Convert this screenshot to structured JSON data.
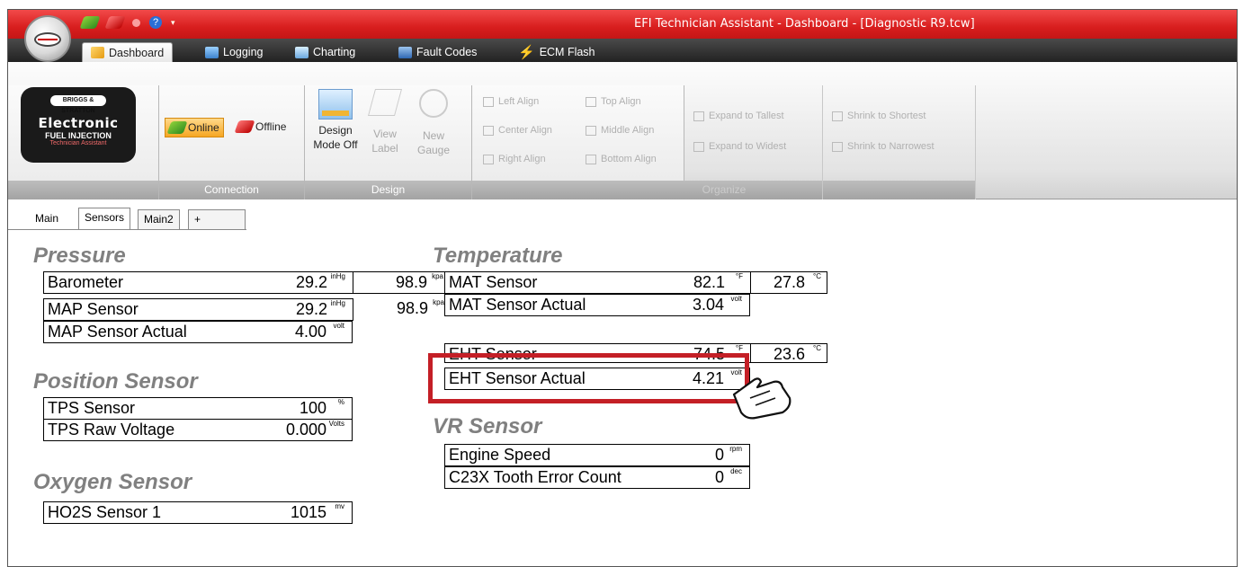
{
  "window": {
    "title": "EFI Technician Assistant - Dashboard - [Diagnostic R9.tcw]"
  },
  "ribbon_tabs": [
    {
      "label": "Dashboard",
      "icon": "dashboard-icon"
    },
    {
      "label": "Logging",
      "icon": "logging-icon"
    },
    {
      "label": "Charting",
      "icon": "charting-icon"
    },
    {
      "label": "Fault Codes",
      "icon": "fault-codes-icon"
    },
    {
      "label": "ECM Flash",
      "icon": "lightning-icon"
    }
  ],
  "brand": {
    "line1": "BRIGGS & STRATTON",
    "line2": "Electronic",
    "line3": "FUEL INJECTION",
    "line4": "Technician Assistant"
  },
  "connection": {
    "label": "Connection",
    "online": "Online",
    "offline": "Offline"
  },
  "design": {
    "label": "Design",
    "mode_line1": "Design",
    "mode_line2": "Mode Off",
    "view1": "View",
    "view2": "Label",
    "new1": "New",
    "new2": "Gauge"
  },
  "align": {
    "left": "Left Align",
    "center": "Center Align",
    "right": "Right Align",
    "top": "Top Align",
    "middle": "Middle Align",
    "bottom": "Bottom Align"
  },
  "expand": {
    "tallest": "Expand to Tallest",
    "widest": "Expand to Widest",
    "shrink_tallest": "Shrink to Shortest",
    "shrink_widest": "Shrink to Narrowest",
    "label": "Organize"
  },
  "work_tabs": [
    "Main",
    "Sensors",
    "Main2",
    "+"
  ],
  "pressure": {
    "title": "Pressure",
    "rows": [
      {
        "label": "Barometer",
        "v1": "29.2",
        "u1": "inHg",
        "v2": "98.9",
        "u2": "kpa"
      },
      {
        "label": "MAP Sensor",
        "v1": "29.2",
        "u1": "inHg",
        "v2": "98.9",
        "u2": "kpa"
      },
      {
        "label": "MAP Sensor Actual",
        "v1": "4.00",
        "u1": "volt"
      }
    ]
  },
  "position": {
    "title": "Position Sensor",
    "rows": [
      {
        "label": "TPS Sensor",
        "v1": "100",
        "u1": "%"
      },
      {
        "label": "TPS Raw Voltage",
        "v1": "0.000",
        "u1": "Volts"
      }
    ]
  },
  "oxygen": {
    "title": "Oxygen Sensor",
    "rows": [
      {
        "label": "HO2S Sensor 1",
        "v1": "1015",
        "u1": "mv"
      }
    ]
  },
  "temperature": {
    "title": "Temperature",
    "rows": [
      {
        "label": "MAT Sensor",
        "v1": "82.1",
        "u1": "°F",
        "v2": "27.8",
        "u2": "°C"
      },
      {
        "label": "MAT Sensor Actual",
        "v1": "3.04",
        "u1": "volt"
      },
      {
        "label": "EHT Sensor",
        "v1": "74.5",
        "u1": "°F",
        "v2": "23.6",
        "u2": "°C"
      },
      {
        "label": "EHT Sensor Actual",
        "v1": "4.21",
        "u1": "volt"
      }
    ]
  },
  "vr": {
    "title": "VR Sensor",
    "rows": [
      {
        "label": "Engine Speed",
        "v1": "0",
        "u1": "rpm"
      },
      {
        "label": "C23X Tooth Error Count",
        "v1": "0",
        "u1": "dec"
      }
    ]
  },
  "colors": {
    "titlebar": "#d81e1e",
    "highlight": "#c41f26",
    "section": "#808080"
  }
}
